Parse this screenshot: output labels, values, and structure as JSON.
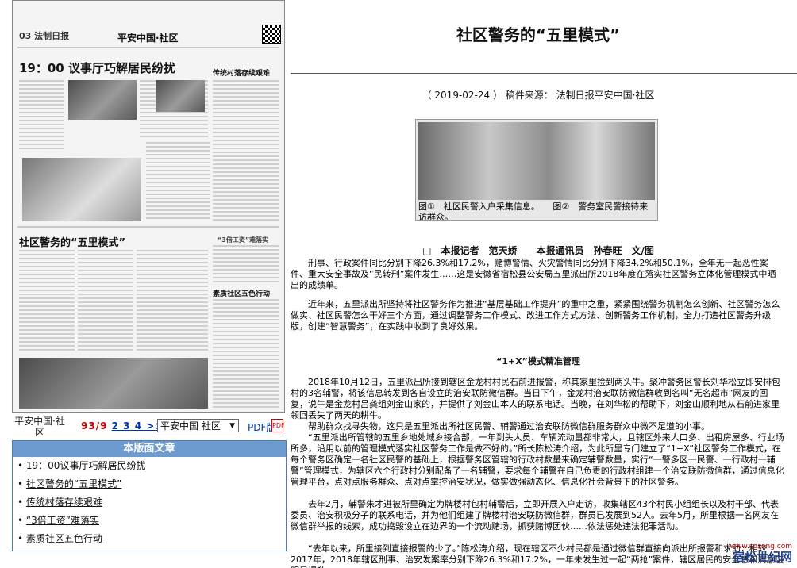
{
  "paper_thumbnail": {
    "page_code": "03 法制日报",
    "section_name": "平安中国·社区",
    "headline_1": "19：00 议事厅巧解居民纷扰",
    "headline_2": "社区警务的“五里模式”",
    "side_headline_1": "传统村落存续艰难",
    "side_headline_2": "“3倍工资”难落实",
    "side_headline_3": "素质社区五色行动"
  },
  "pager": {
    "label": "平安中国·社区",
    "current_page": "9",
    "pages_text": "3/9",
    "page_links": "2 3 4 >",
    "last_link": "≫|",
    "select_value": "平安中国 社区",
    "pdf_label": "PDF版",
    "pdf_icon": "pdf-icon"
  },
  "articles": {
    "heading": "本版面文章",
    "items": [
      "19：00议事厅巧解居民纷扰",
      "社区警务的“五里模式”",
      "传统村落存续艰难",
      "“3倍工资”难落实",
      "素质社区五色行动"
    ]
  },
  "article": {
    "title": "社区警务的“五里模式”",
    "meta": "（ 2019-02-24 ） 稿件来源： 法制日报平安中国·社区",
    "photo_caption": "图①　社区民警入户采集信息。　　图②　警务室民警接待来访群众。",
    "byline": "□　本报记者　范天娇　　本报通讯员　孙春旺　文/图",
    "paragraphs": [
      "刑事、行政案件同比分别下降26.3%和17.2%，赌博警情、火灾警情同比分别下降34.2%和50.1%，全年无一起恶性案件、重大安全事故及“民转刑”案件发生……这是安徽省宿松县公安局五里派出所2018年度在落实社区警务立体化管理模式中晒出的成绩单。",
      "近年来，五里派出所坚持将社区警务作为推进“基层基础工作提升”的重中之重，紧紧围绕警务机制怎么创新、社区警务怎么做实、社区民警怎么干好三个方面，通过调整警务工作模式、改进工作方式方法、创新警务工作机制，全力打造社区警务升级版，创建“智慧警务”，在实践中收到了良好效果。"
    ],
    "subheading": "“1+X”模式精准管理",
    "paragraphs_2": [
      "2018年10月12日，五里派出所接到辖区金龙村村民石前进报警，称其家里捡到两头牛。聚冲警务区警长刘华松立即安排包村的3名辅警，将该信息转发到各自设立的治安联防微信群。当日下午，金龙村治安联防微信群收到名叫“无名超市”网友的回复，说牛是金龙村吕龚组刘金山家的，并提供了刘金山本人的联系电话。当晚，在刘华松的帮助下，刘金山顺利地从石前进家里领回丢失了两天的耕牛。",
      "帮助群众找寻失物，这只是五里派出所社区民警、辅警通过治安联防微信群服务群众中微不足道的小事。",
      "“五里派出所管辖的五里乡地处城乡接合部，一年到头人员、车辆流动量都非常大，且辖区外来人口多、出租房屋多、行业场所多，沿用以前的管理模式落实社区警务工作是做不好的。”所长陈松涛介绍，为此所里专门建立了“1+X”社区警务工作模式，在每个警务区确定一名社区民警的基础上，根据警务区管辖的行政村数量来确定辅警数量，实行“一警多区一民警、一行政村一辅警”管理模式，为辖区六个行政村分别配备了一名辅警，要求每个辅警在自己负责的行政村组建一个治安联防微信群，通过信息化管理平台，点对点服务群众、点对点掌控治安状况，做实做强动态化、信息化社会背景下的社区警务。",
      "去年2月，辅警朱才进被所里确定为牌楼村包村辅警后，立即开展入户走访，收集辖区43个村民小组组长以及村干部、代表委员、治安积极分子的联系电话，并为他们组建了牌楼村治安联防微信群，群员已发展到52人。去年5月，所里根据一名网友在微信群举报的线索，成功捣毁设立在边界的一个流动赌场，抓获赌博团伙……依法惩处违法犯罪活动。",
      "“去年以来，所里接到直接报警的少了。”陈松涛介绍，现在辖区不少村民都是通过微信群直接向派出所报警和求助；相较2017年，2018年辖区刑事、治安发案率分别下降26.3%和17.2%，一年未发生过一起“两抢”案件，辖区居民的安全感和满意度明显提升。"
    ]
  },
  "watermark": {
    "text": "宿松世纪网",
    "url": "www.susong.com"
  }
}
